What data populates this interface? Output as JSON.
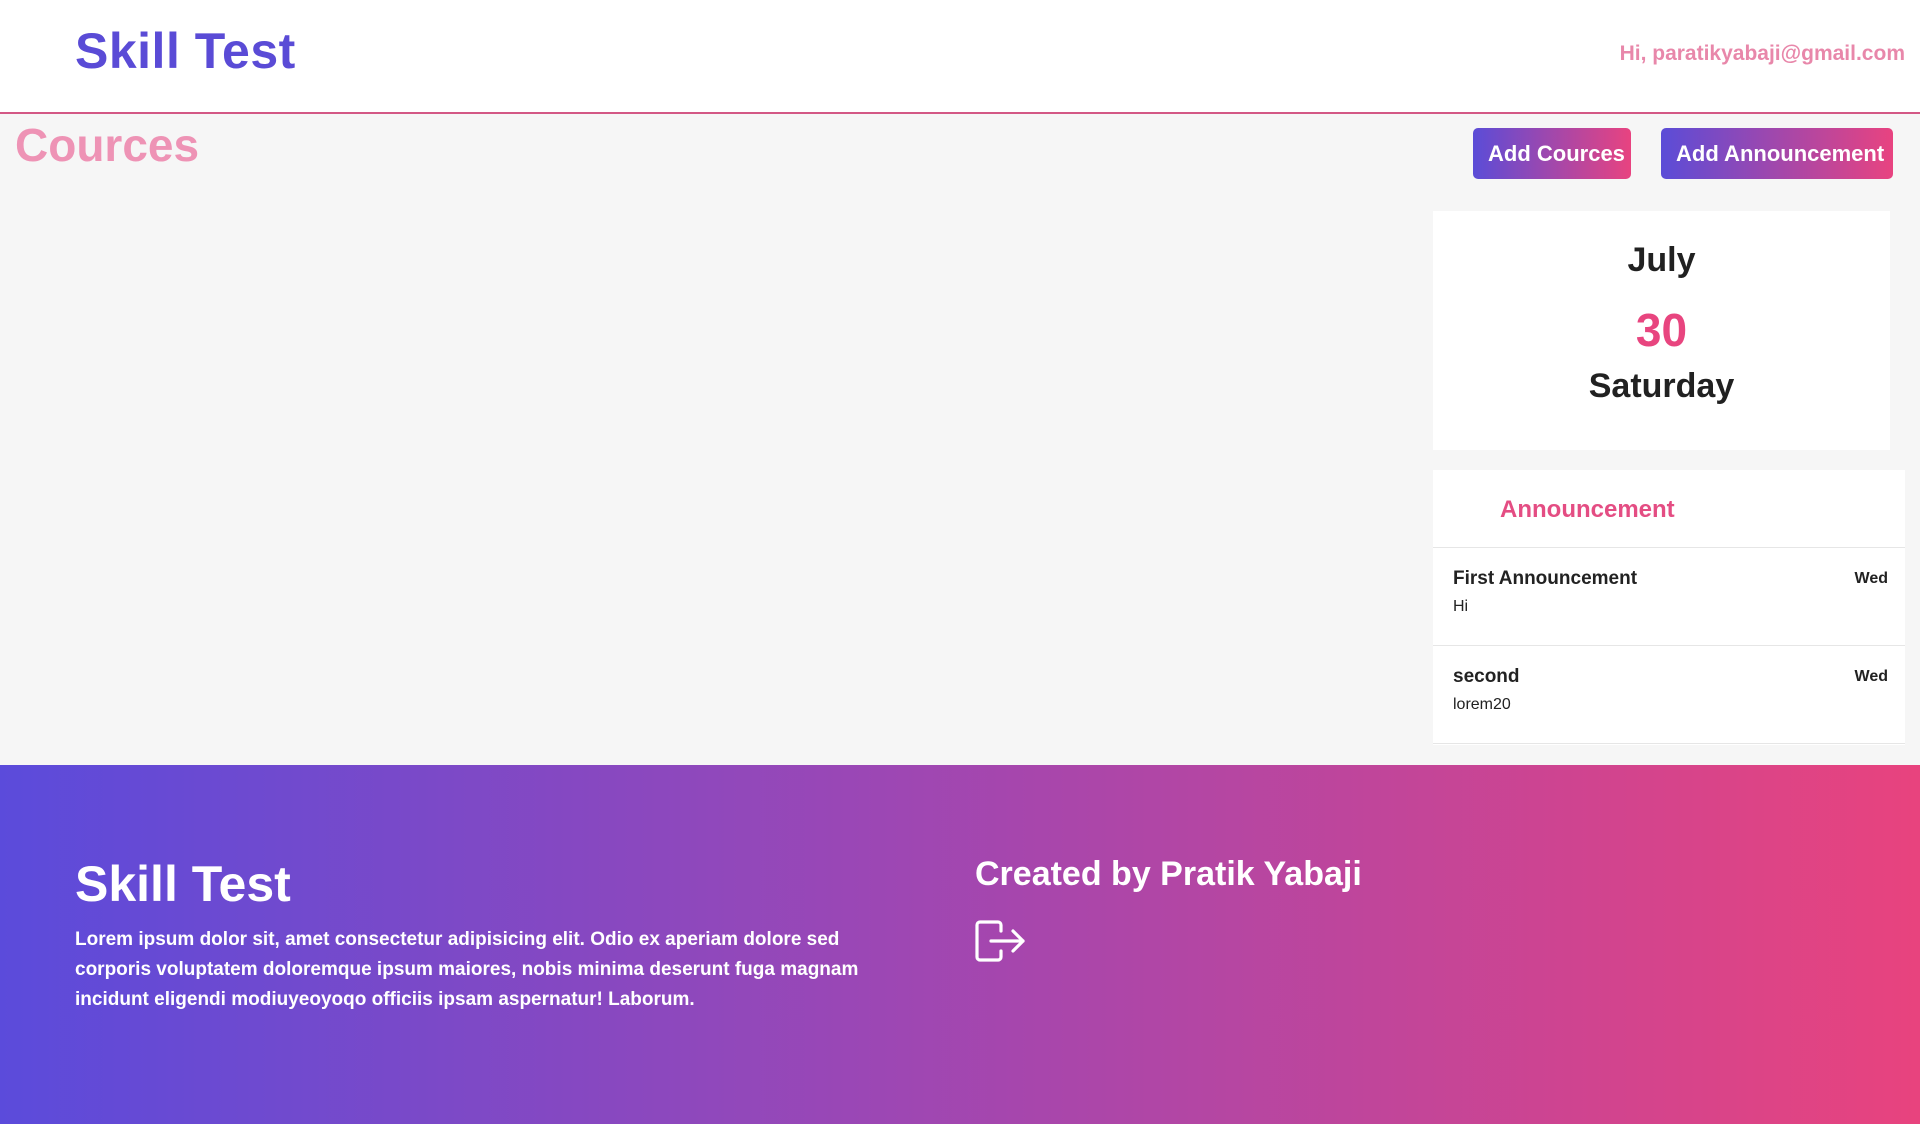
{
  "header": {
    "brand": "Skill Test",
    "greeting": "Hi, paratikyabaji@gmail.com"
  },
  "main": {
    "section_title": "Cources",
    "add_cources_label": "Add Cources",
    "add_announcement_label": "Add Announcement"
  },
  "date_card": {
    "month": "July",
    "day": "30",
    "weekday": "Saturday"
  },
  "announcements": {
    "title": "Announcement",
    "items": [
      {
        "title": "First Announcement",
        "body": "Hi",
        "day": "Wed"
      },
      {
        "title": "second",
        "body": "lorem20",
        "day": "Wed"
      }
    ]
  },
  "footer": {
    "brand": "Skill Test",
    "description": "Lorem ipsum dolor sit, amet consectetur adipisicing elit. Odio ex aperiam dolore sed corporis voluptatem doloremque ipsum maiores, nobis minima deserunt fuga magnam incidunt eligendi modiuyeoyoqo officiis ipsam aspernatur! Laborum.",
    "credit": "Created by Pratik Yabaji",
    "logout_icon": "logout-icon"
  },
  "colors": {
    "brand_purple": "#5a4bd6",
    "accent_pink": "#e8457f",
    "gradient_start": "#5b4cd7",
    "gradient_end": "#e84380"
  }
}
